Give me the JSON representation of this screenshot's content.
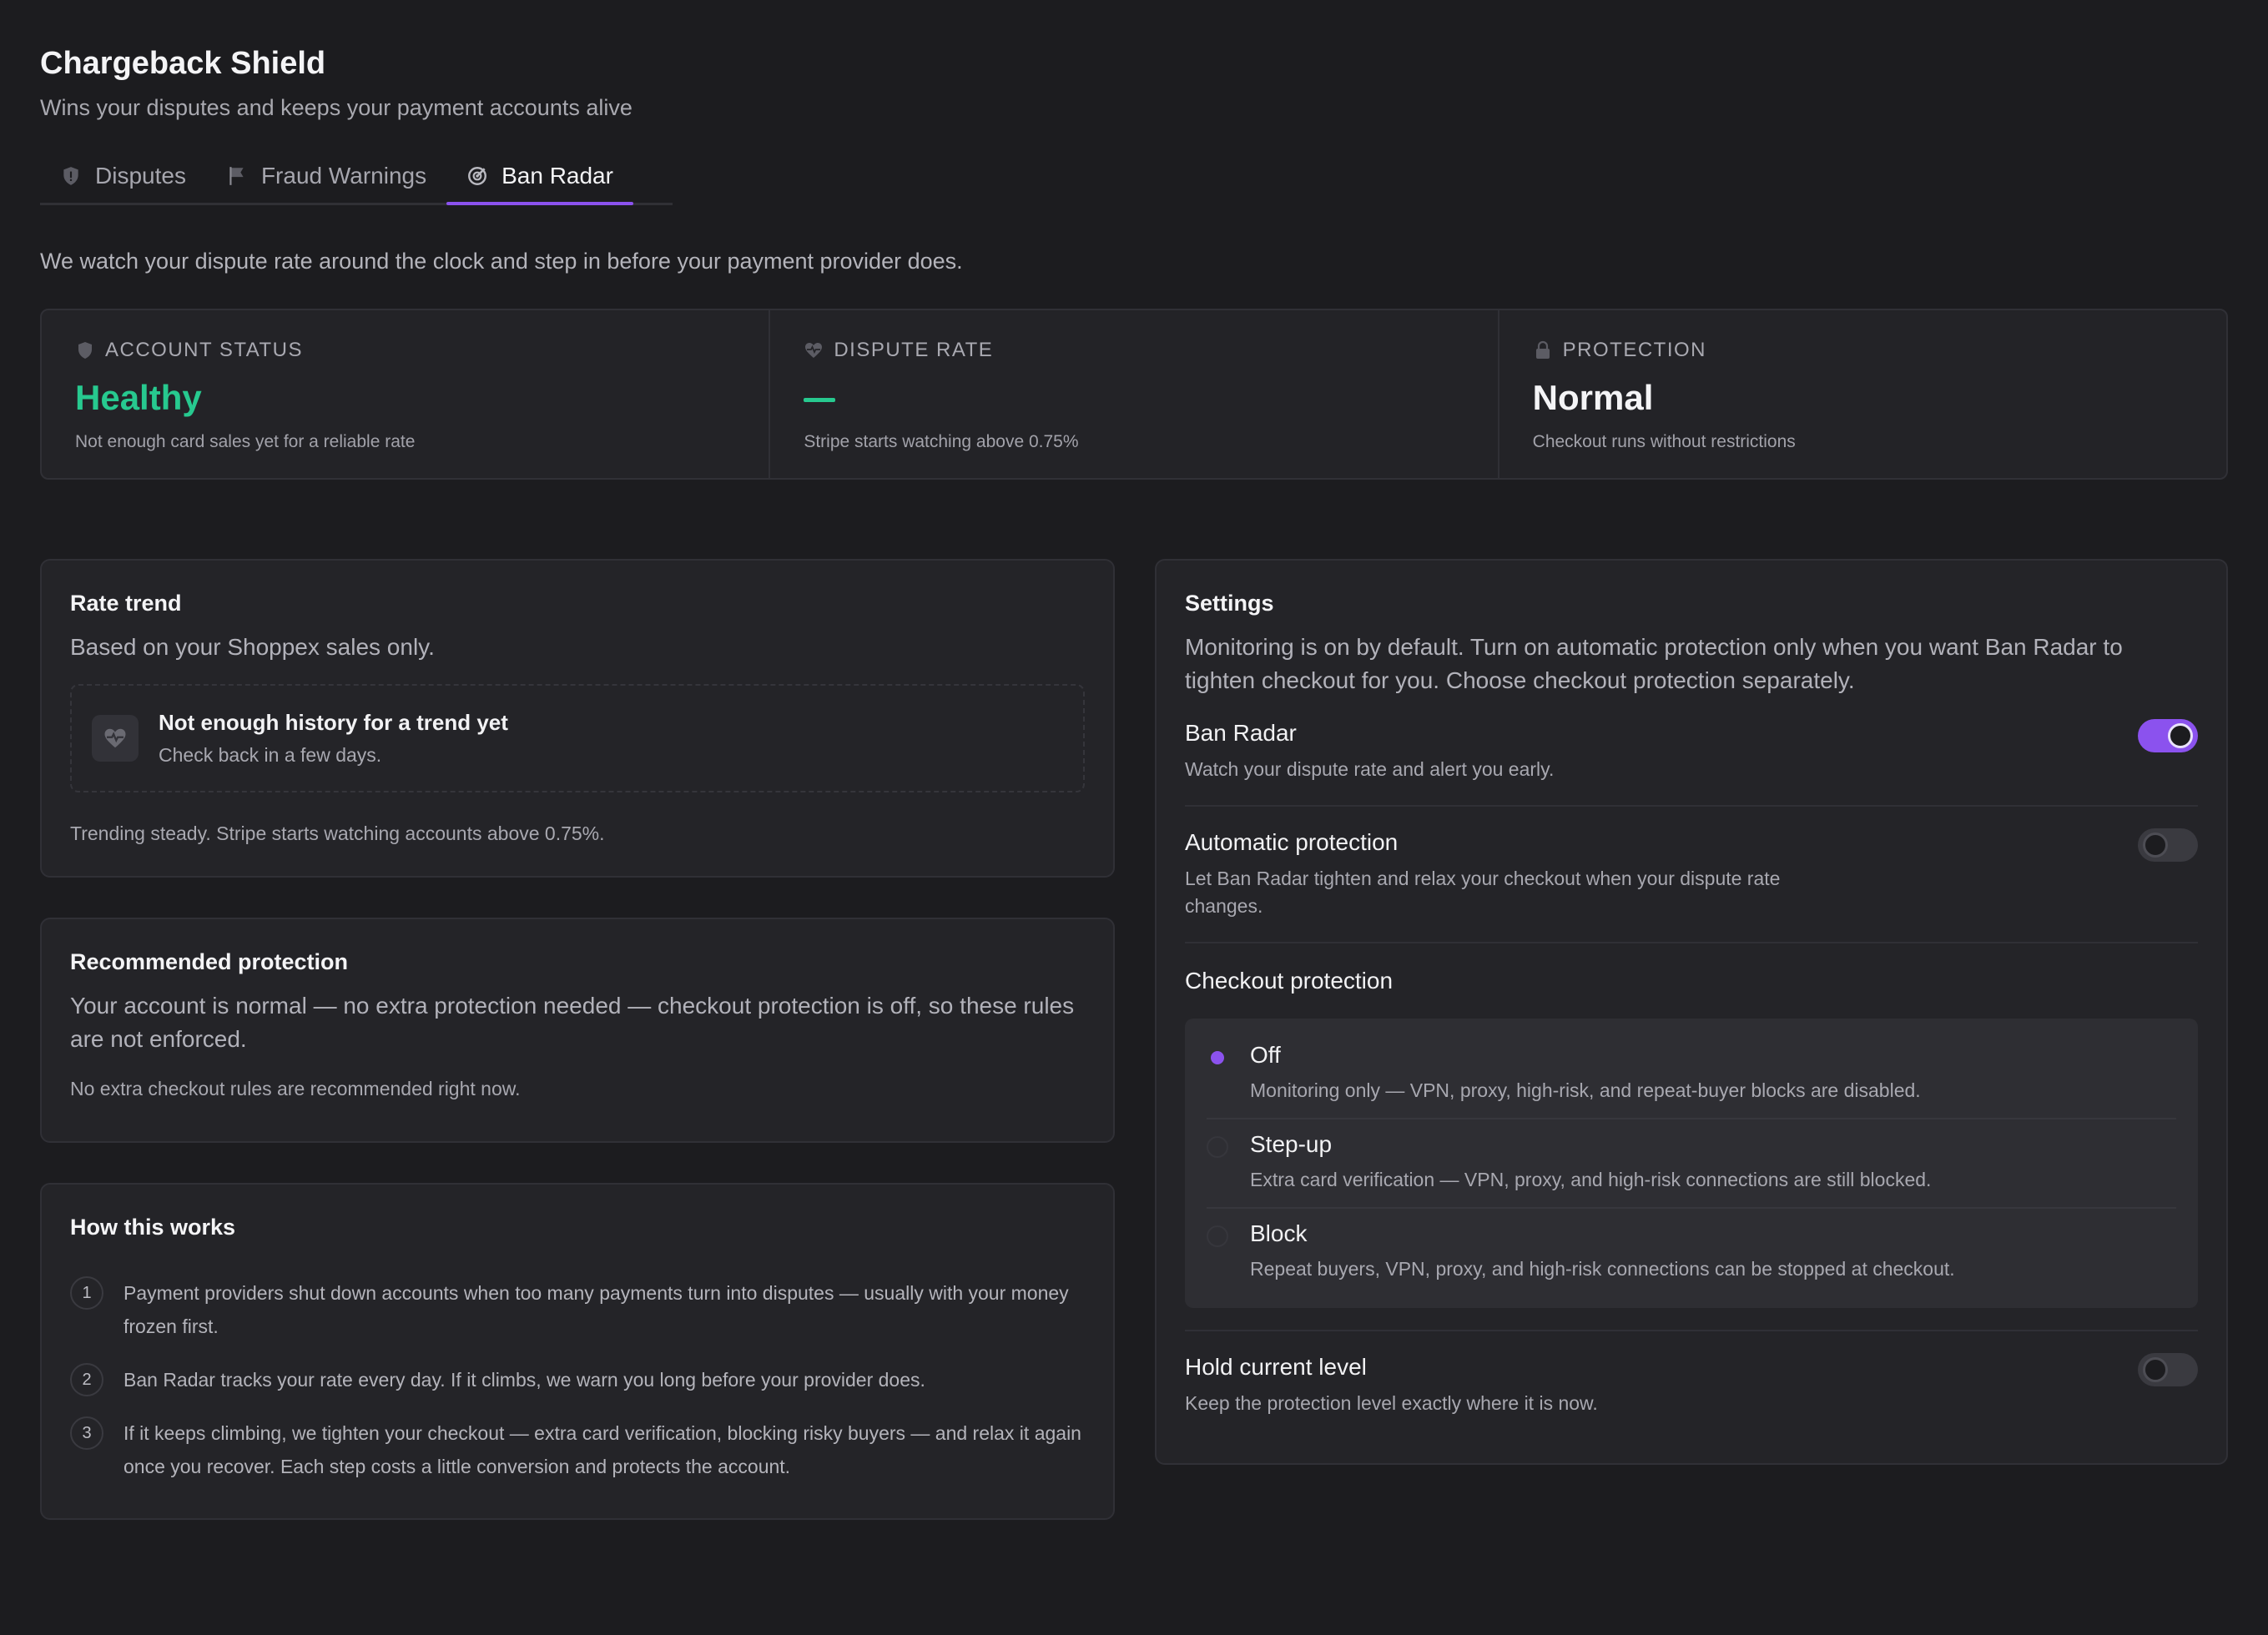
{
  "header": {
    "title": "Chargeback Shield",
    "subtitle": "Wins your disputes and keeps your payment accounts alive"
  },
  "tabs": [
    {
      "label": "Disputes",
      "icon": "shield-alert-icon",
      "active": false
    },
    {
      "label": "Fraud Warnings",
      "icon": "flag-icon",
      "active": false
    },
    {
      "label": "Ban Radar",
      "icon": "radar-icon",
      "active": true
    }
  ],
  "intro": "We watch your dispute rate around the clock and step in before your payment provider does.",
  "status": {
    "account": {
      "label": "Account status",
      "value": "Healthy",
      "note": "Not enough card sales yet for a reliable rate"
    },
    "dispute_rate": {
      "label": "Dispute rate",
      "value": "—",
      "note": "Stripe starts watching above 0.75%"
    },
    "protection": {
      "label": "Protection",
      "value": "Normal",
      "note": "Checkout runs without restrictions"
    }
  },
  "rate_trend": {
    "title": "Rate trend",
    "subtitle": "Based on your Shoppex sales only.",
    "empty_title": "Not enough history for a trend yet",
    "empty_sub": "Check back in a few days.",
    "footer": "Trending steady. Stripe starts watching accounts above 0.75%."
  },
  "recommended": {
    "title": "Recommended protection",
    "body": "Your account is normal — no extra protection needed — checkout protection is off, so these rules are not enforced.",
    "note": "No extra checkout rules are recommended right now."
  },
  "how": {
    "title": "How this works",
    "steps": [
      {
        "num": "1",
        "text": "Payment providers shut down accounts when too many payments turn into disputes — usually with your money frozen first."
      },
      {
        "num": "2",
        "text": "Ban Radar tracks your rate every day. If it climbs, we warn you long before your provider does."
      },
      {
        "num": "3",
        "text": "If it keeps climbing, we tighten your checkout — extra card verification, blocking risky buyers — and relax it again once you recover. Each step costs a little conversion and protects the account."
      }
    ]
  },
  "settings": {
    "title": "Settings",
    "intro": "Monitoring is on by default. Turn on automatic protection only when you want Ban Radar to tighten checkout for you. Choose checkout protection separately.",
    "ban_radar": {
      "title": "Ban Radar",
      "desc": "Watch your dispute rate and alert you early.",
      "on": true
    },
    "auto_protection": {
      "title": "Automatic protection",
      "desc": "Let Ban Radar tighten and relax your checkout when your dispute rate changes.",
      "on": false
    },
    "checkout_title": "Checkout protection",
    "options": [
      {
        "title": "Off",
        "desc": "Monitoring only — VPN, proxy, high-risk, and repeat-buyer blocks are disabled.",
        "selected": true
      },
      {
        "title": "Step-up",
        "desc": "Extra card verification — VPN, proxy, and high-risk connections are still blocked.",
        "selected": false
      },
      {
        "title": "Block",
        "desc": "Repeat buyers, VPN, proxy, and high-risk connections can be stopped at checkout.",
        "selected": false
      }
    ],
    "hold": {
      "title": "Hold current level",
      "desc": "Keep the protection level exactly where it is now.",
      "on": false
    }
  },
  "colors": {
    "accent": "#8b52ee",
    "healthy": "#27c98f",
    "background": "#1c1c1f",
    "card": "#242428"
  }
}
